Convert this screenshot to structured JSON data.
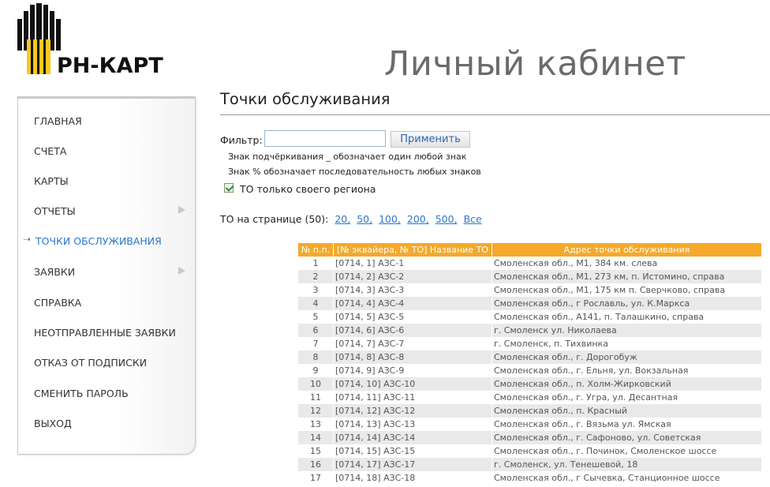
{
  "logo": {
    "text": "РН-КАРТ"
  },
  "header": {
    "title": "Личный кабинет"
  },
  "sidebar": {
    "items": [
      {
        "label": "ГЛАВНАЯ",
        "has_submenu": false,
        "active": false
      },
      {
        "label": "СЧЕТА",
        "has_submenu": false,
        "active": false
      },
      {
        "label": "КАРТЫ",
        "has_submenu": false,
        "active": false
      },
      {
        "label": "ОТЧЕТЫ",
        "has_submenu": true,
        "active": false
      },
      {
        "label": "ТОЧКИ ОБСЛУЖИВАНИЯ",
        "has_submenu": false,
        "active": true
      },
      {
        "label": "ЗАЯВКИ",
        "has_submenu": true,
        "active": false
      },
      {
        "label": "СПРАВКА",
        "has_submenu": false,
        "active": false
      },
      {
        "label": "НЕОТПРАВЛЕННЫЕ ЗАЯВКИ",
        "has_submenu": false,
        "active": false
      },
      {
        "label": "ОТКАЗ ОТ ПОДПИСКИ",
        "has_submenu": false,
        "active": false
      },
      {
        "label": "СМЕНИТЬ ПАРОЛЬ",
        "has_submenu": false,
        "active": false
      },
      {
        "label": "ВЫХОД",
        "has_submenu": false,
        "active": false
      }
    ]
  },
  "main": {
    "title": "Точки обслуживания",
    "filter": {
      "label": "Фильтр:",
      "value": "",
      "button": "Применить",
      "hint1": "Знак подчёркивания _ обозначает один любой знак",
      "hint2": "Знак % обозначает последовательность любых знаков",
      "region_only_label": "ТО только своего региона",
      "region_only_checked": true
    },
    "per_page": {
      "label": "ТО на странице (50):",
      "options": [
        "20,",
        "50,",
        "100,",
        "200,",
        "500,",
        "Все"
      ]
    },
    "table": {
      "headers": [
        "№ п.п.",
        "[№ эквайера, № ТО] Название ТО",
        "Адрес точки обслуживания"
      ],
      "rows": [
        [
          "1",
          "[0714, 1] АЗС-1",
          "Смоленская обл., М1, 384 км. слева"
        ],
        [
          "2",
          "[0714, 2] АЗС-2",
          "Смоленская обл., М1, 273 км, п. Истомино, справа"
        ],
        [
          "3",
          "[0714, 3] АЗС-3",
          "Смоленская обл., М1, 175 км п. Сверчково, справа"
        ],
        [
          "4",
          "[0714, 4] АЗС-4",
          "Смоленская обл., г Рославль, ул. К.Маркса"
        ],
        [
          "5",
          "[0714, 5] АЗС-5",
          "Смоленская обл., А141, п. Талашкино, справа"
        ],
        [
          "6",
          "[0714, 6] АЗС-6",
          "г. Смоленск ул. Николаева"
        ],
        [
          "7",
          "[0714, 7] АЗС-7",
          "г. Смоленск, п. Тихвинка"
        ],
        [
          "8",
          "[0714, 8] АЗС-8",
          "Смоленская обл., г. Дорогобуж"
        ],
        [
          "9",
          "[0714, 9] АЗС-9",
          "Смоленская обл., г. Ельня, ул. Вокзальная"
        ],
        [
          "10",
          "[0714, 10] АЗС-10",
          "Смоленская обл., п. Холм-Жирковский"
        ],
        [
          "11",
          "[0714, 11] АЗС-11",
          "Смоленская обл., г. Угра, ул. Десантная"
        ],
        [
          "12",
          "[0714, 12] АЗС-12",
          "Смоленская обл., п. Красный"
        ],
        [
          "13",
          "[0714, 13] АЗС-13",
          "Смоленская обл., г. Вязьма ул. Ямская"
        ],
        [
          "14",
          "[0714, 14] АЗС-14",
          "Смоленская обл., г. Сафоново, ул. Советская"
        ],
        [
          "15",
          "[0714, 15] АЗС-15",
          "Смоленская обл., г. Починок, Смоленское шоссе"
        ],
        [
          "16",
          "[0714, 17] АЗС-17",
          "г. Смоленск, ул. Тенешевой, 18"
        ],
        [
          "17",
          "[0714, 18] АЗС-18",
          "Смоленская обл., г Сычевка, Станционное шоссе"
        ]
      ]
    }
  },
  "colors": {
    "accent": "#2a79c9",
    "table_header": "#f4a92a",
    "logo_yellow": "#f7c81e",
    "logo_black": "#111111"
  },
  "icons": {
    "logo_mark": "rosneft-logo-icon",
    "submenu_arrow": "triangle-right-icon",
    "active_bullet": "arrow-right-icon",
    "checkbox": "checkmark-icon"
  }
}
